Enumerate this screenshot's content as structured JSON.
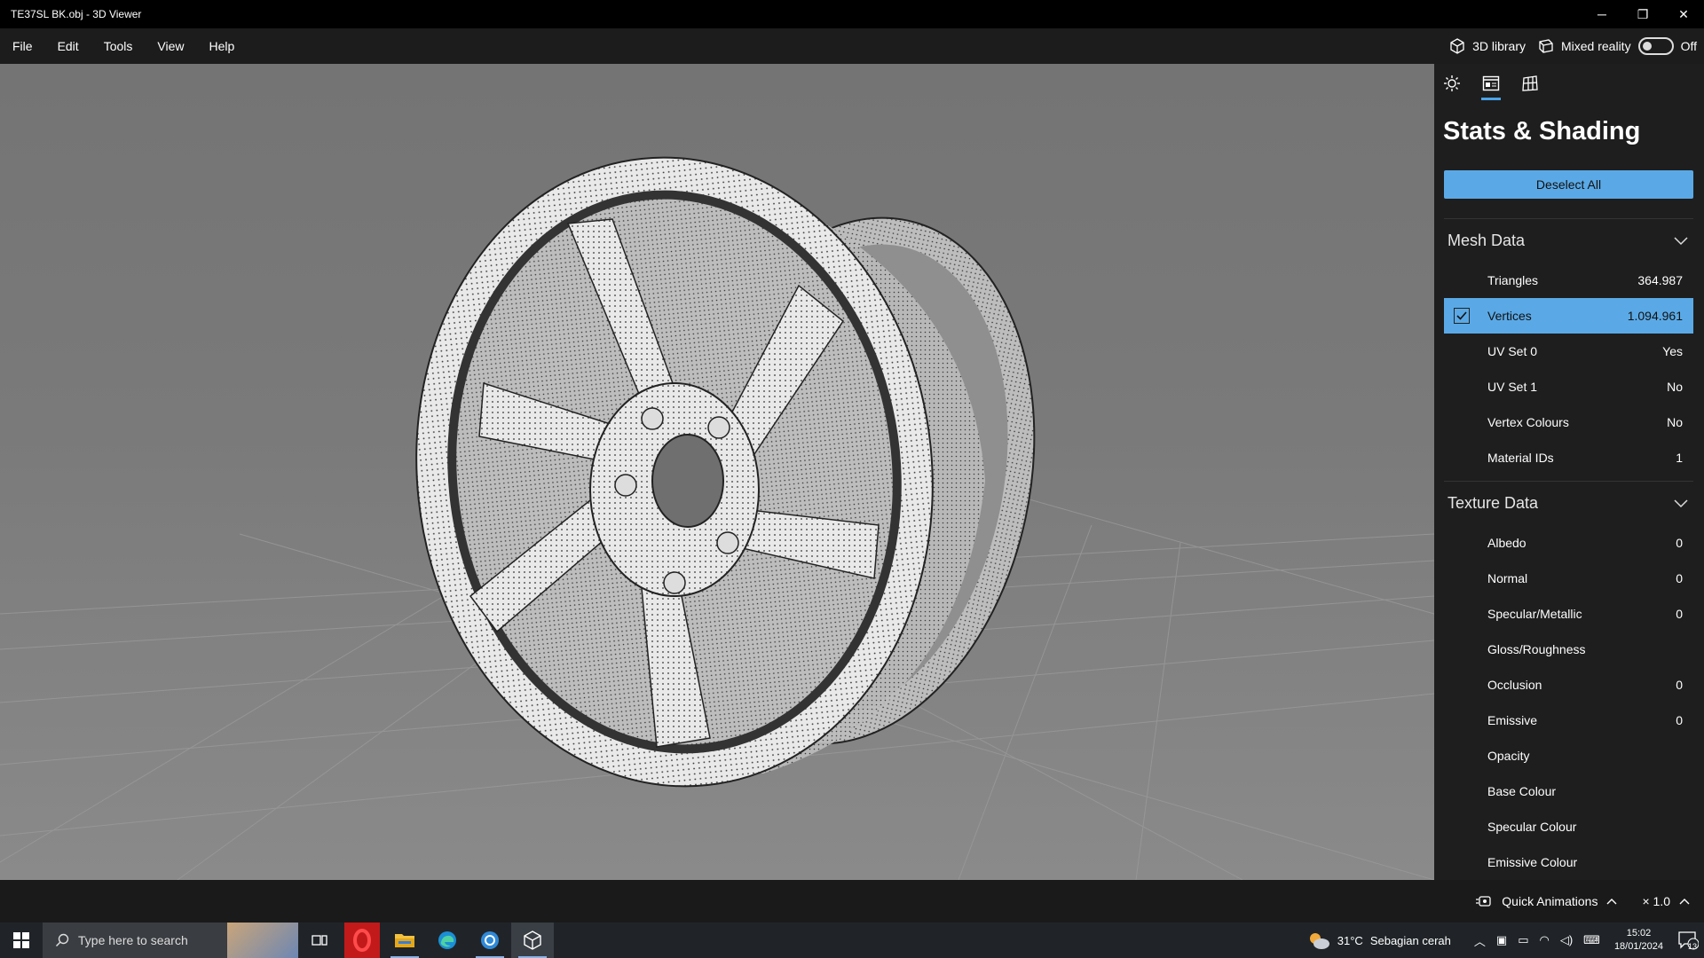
{
  "window": {
    "title": "TE37SL BK.obj - 3D Viewer",
    "controls": {
      "minimize": "─",
      "restore": "❐",
      "close": "✕"
    }
  },
  "menu": {
    "items": [
      "File",
      "Edit",
      "Tools",
      "View",
      "Help"
    ],
    "library_label": "3D library",
    "mixed_reality_label": "Mixed reality",
    "mixed_reality_state": "Off"
  },
  "panel": {
    "title": "Stats & Shading",
    "deselect_label": "Deselect All",
    "accent": "#5aa9e6",
    "mesh": {
      "label": "Mesh Data",
      "rows": [
        {
          "label": "Triangles",
          "value": "364.987"
        },
        {
          "label": "Vertices",
          "value": "1.094.961",
          "selected": true
        },
        {
          "label": "UV Set 0",
          "value": "Yes"
        },
        {
          "label": "UV Set 1",
          "value": "No"
        },
        {
          "label": "Vertex Colours",
          "value": "No"
        },
        {
          "label": "Material IDs",
          "value": "1"
        }
      ]
    },
    "texture": {
      "label": "Texture Data",
      "rows": [
        {
          "label": "Albedo",
          "value": "0"
        },
        {
          "label": "Normal",
          "value": "0"
        },
        {
          "label": "Specular/Metallic",
          "value": "0"
        },
        {
          "label": "Gloss/Roughness",
          "value": ""
        },
        {
          "label": "Occlusion",
          "value": "0"
        },
        {
          "label": "Emissive",
          "value": "0"
        },
        {
          "label": "Opacity",
          "value": ""
        },
        {
          "label": "Base Colour",
          "value": ""
        },
        {
          "label": "Specular Colour",
          "value": ""
        },
        {
          "label": "Emissive Colour",
          "value": ""
        }
      ]
    }
  },
  "statusbar": {
    "quick_animations": "Quick Animations",
    "speed": "× 1.0"
  },
  "taskbar": {
    "search_placeholder": "Type here to search",
    "weather_temp": "31°C",
    "weather_desc": "Sebagian cerah",
    "time": "15:02",
    "date": "18/01/2024",
    "notifications": "13"
  }
}
